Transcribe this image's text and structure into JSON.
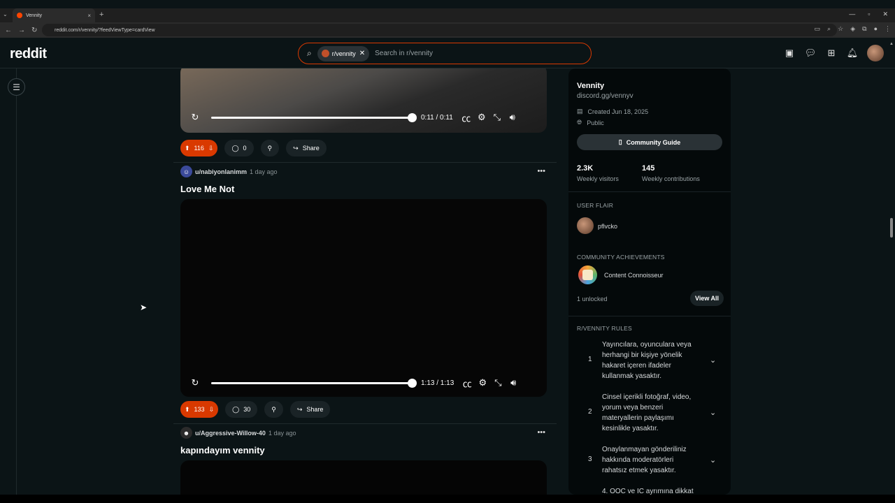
{
  "browser": {
    "tab_title": "Vennity",
    "tab_close": "×",
    "new_tab": "+",
    "url": "reddit.com/r/vennity/?feedViewType=cardView"
  },
  "header": {
    "logo": "reddit",
    "search_chip": "r/vennity",
    "search_placeholder": "Search in r/vennity"
  },
  "feed": {
    "post1": {
      "time": "0:11 / 0:11",
      "votes": "116",
      "comments": "0",
      "share": "Share"
    },
    "post2": {
      "user": "u/nabiyonlanimm",
      "age": "1 day ago",
      "title": "Love Me Not",
      "time": "1:13 / 1:13",
      "votes": "133",
      "comments": "30",
      "share": "Share"
    },
    "post3": {
      "user": "u/Aggressive-Willow-40",
      "age": "1 day ago",
      "title": "kapındayım vennity"
    }
  },
  "sidebar": {
    "name": "Vennity",
    "link": "discord.gg/vennyv",
    "created": "Created Jun 18, 2025",
    "visibility": "Public",
    "guide_button": "Community Guide",
    "visitors_count": "2.3K",
    "visitors_label": "Weekly visitors",
    "contrib_count": "145",
    "contrib_label": "Weekly contributions",
    "flair_heading": "USER FLAIR",
    "flair_name": "pflvcko",
    "ach_heading": "COMMUNITY ACHIEVEMENTS",
    "ach_name": "Content Connoisseur",
    "unlocked": "1 unlocked",
    "view_all": "View All",
    "rules_heading": "R/VENNITY RULES",
    "rules": [
      {
        "num": "1",
        "text": "Yayıncılara, oyunculara veya herhangi bir kişiye yönelik hakaret içeren ifadeler kullanmak yasaktır."
      },
      {
        "num": "2",
        "text": "Cinsel içerikli fotoğraf, video, yorum veya benzeri materyallerin paylaşımı kesinlikle yasaktır."
      },
      {
        "num": "3",
        "text": "Onaylanmayan gönderiliniz hakkında moderatörleri rahatsız etmek yasaktır."
      },
      {
        "num": "",
        "text": "4. OOC ve IC ayrımına dikkat"
      }
    ]
  },
  "colors": {
    "accent": "#d93900",
    "background": "#0b1416",
    "sidebar": "#04090a"
  }
}
